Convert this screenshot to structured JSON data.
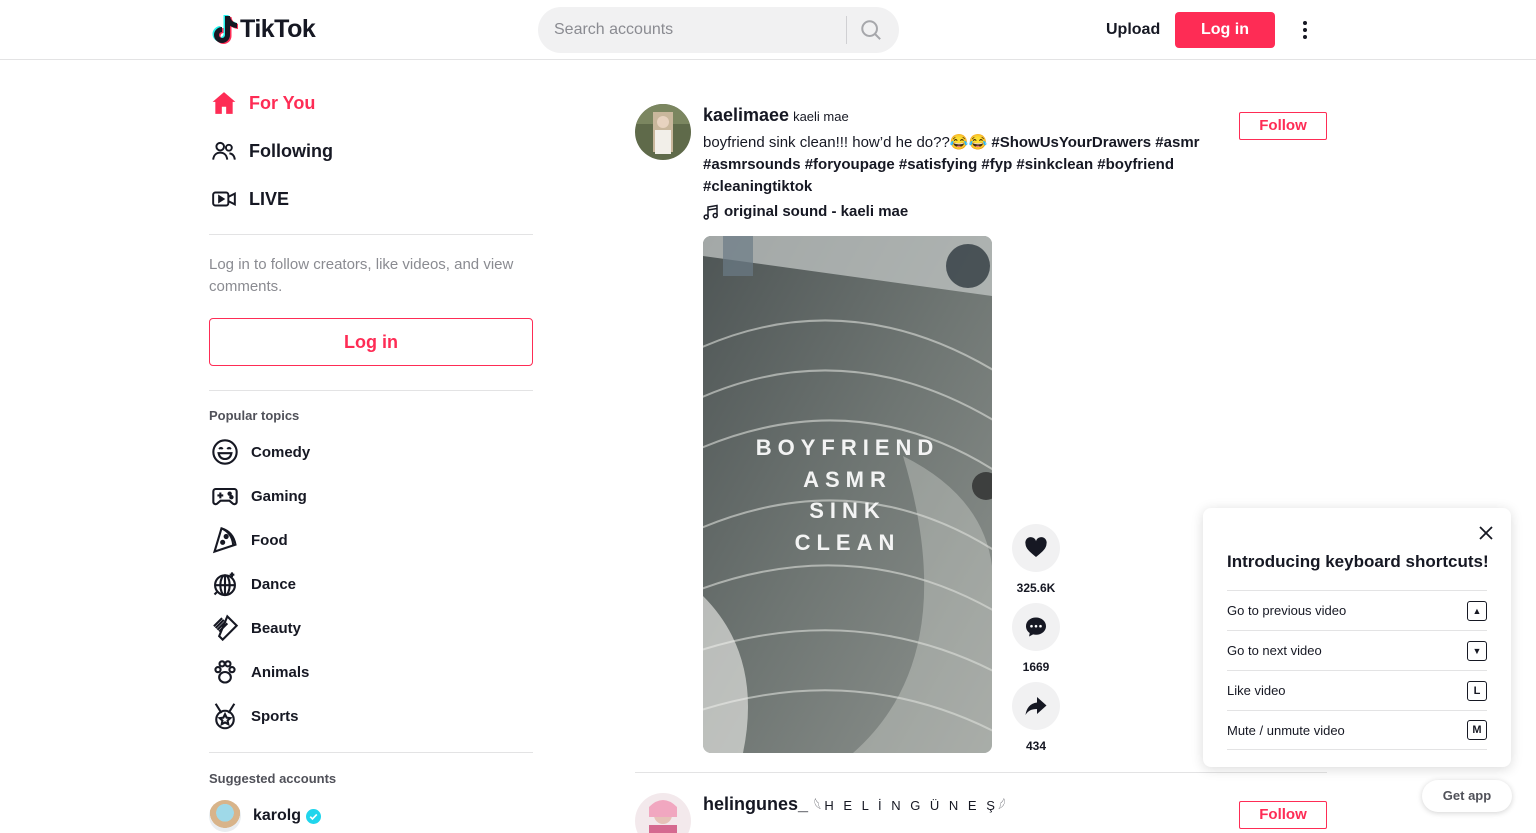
{
  "header": {
    "logo_text": "TikTok",
    "search_placeholder": "Search accounts",
    "upload_label": "Upload",
    "login_label": "Log in",
    "accent_color": "#fe2c55"
  },
  "sidebar": {
    "nav": [
      {
        "label": "For You",
        "icon": "home-icon"
      },
      {
        "label": "Following",
        "icon": "people-icon"
      },
      {
        "label": "LIVE",
        "icon": "live-icon"
      }
    ],
    "login_hint": "Log in to follow creators, like videos, and view comments.",
    "login_button": "Log in",
    "popular_topics_title": "Popular topics",
    "topics": [
      {
        "label": "Comedy",
        "icon": "laugh-icon"
      },
      {
        "label": "Gaming",
        "icon": "gamepad-icon"
      },
      {
        "label": "Food",
        "icon": "pizza-icon"
      },
      {
        "label": "Dance",
        "icon": "disco-ball-icon"
      },
      {
        "label": "Beauty",
        "icon": "comb-icon"
      },
      {
        "label": "Animals",
        "icon": "paw-icon"
      },
      {
        "label": "Sports",
        "icon": "medal-icon"
      }
    ],
    "suggested_title": "Suggested accounts",
    "suggested": [
      {
        "username": "karolg",
        "verified": true
      }
    ]
  },
  "feed": {
    "posts": [
      {
        "username": "kaelimaee",
        "nickname": "kaeli mae",
        "caption_text": "boyfriend sink clean!!! how’d he do??😂😂 ",
        "hashtags_line1": "#ShowUsYourDrawers #asmr",
        "hashtags_line2": "#asmrsounds #foryoupage #satisfying #fyp #sinkclean #boyfriend",
        "hashtags_line3": "#cleaningtiktok",
        "music": "original sound - kaeli mae",
        "follow_label": "Follow",
        "video_overlay": [
          "BOYFRIEND",
          "ASMR",
          "SINK",
          "CLEAN"
        ],
        "likes": "325.6K",
        "comments": "1669",
        "shares": "434"
      },
      {
        "username": "helingunes_",
        "nickname": "𓆩H E L İ N G Ü N E Ş𓆪",
        "follow_label": "Follow"
      }
    ]
  },
  "shortcuts": {
    "title": "Introducing keyboard shortcuts!",
    "rows": [
      {
        "label": "Go to previous video",
        "key": "▲"
      },
      {
        "label": "Go to next video",
        "key": "▼"
      },
      {
        "label": "Like video",
        "key": "L"
      },
      {
        "label": "Mute / unmute video",
        "key": "M"
      }
    ]
  },
  "get_app_label": "Get app"
}
